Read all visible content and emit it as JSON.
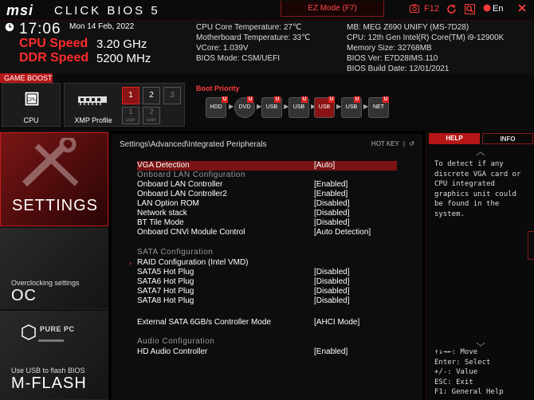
{
  "topbar": {
    "logo": "msi",
    "brand": "CLICK BIOS 5",
    "ez_mode": "EZ Mode (F7)",
    "f12": "F12",
    "language": "En"
  },
  "status": {
    "time": "17:06",
    "date": "Mon 14 Feb, 2022",
    "cpu_speed_label": "CPU Speed",
    "cpu_speed_value": "3.20 GHz",
    "ddr_speed_label": "DDR Speed",
    "ddr_speed_value": "5200 MHz"
  },
  "sysinfo_left": [
    "CPU Core Temperature: 27℃",
    "Motherboard Temperature: 33℃",
    "VCore: 1.039V",
    "BIOS Mode: CSM/UEFI"
  ],
  "sysinfo_right": [
    "MB: MEG Z690 UNIFY (MS-7D28)",
    "CPU: 12th Gen Intel(R) Core(TM) i9-12900K",
    "Memory Size: 32768MB",
    "BIOS Ver: E7D28IMS.110",
    "BIOS Build Date: 12/01/2021"
  ],
  "game_boost": {
    "label": "GAME BOOST",
    "cpu": "CPU",
    "xmp": "XMP Profile",
    "profiles": [
      "1",
      "2",
      "3"
    ],
    "user_profiles": [
      "1",
      "2"
    ],
    "user_label": "user"
  },
  "boot": {
    "title": "Boot Priority",
    "devices": [
      "HDD",
      "DVD",
      "USB",
      "USB",
      "USB",
      "USB",
      "NET"
    ],
    "badge": "U"
  },
  "nav": {
    "settings": "SETTINGS",
    "oc_sub": "Overclocking settings",
    "oc": "OC",
    "pure_pc": "PURE PC",
    "mflash_sub": "Use USB to flash BIOS",
    "mflash": "M-FLASH"
  },
  "main": {
    "breadcrumb": "Settings\\Advanced\\Integrated Peripherals",
    "hotkey": "HOT KEY",
    "hotkey_sep": "|",
    "back": "↺",
    "rows": [
      {
        "label": "VGA Detection",
        "value": "[Auto]"
      },
      {
        "label": "Onboard LAN Configuration",
        "value": ""
      },
      {
        "label": "Onboard LAN Controller",
        "value": "[Enabled]"
      },
      {
        "label": "Onboard LAN Controller2",
        "value": "[Enabled]"
      },
      {
        "label": "LAN Option ROM",
        "value": "[Disabled]"
      },
      {
        "label": "Network stack",
        "value": "[Disabled]"
      },
      {
        "label": "BT Tile Mode",
        "value": "[Disabled]"
      },
      {
        "label": "Onboard CNVi Module Control",
        "value": "[Auto Detection]"
      },
      {
        "label": "SATA Configuration",
        "value": ""
      },
      {
        "label": "RAID Configuration (Intel VMD)",
        "value": ""
      },
      {
        "label": "SATA5 Hot Plug",
        "value": "[Disabled]"
      },
      {
        "label": "SATA6 Hot Plug",
        "value": "[Disabled]"
      },
      {
        "label": "SATA7 Hot Plug",
        "value": "[Disabled]"
      },
      {
        "label": "SATA8 Hot Plug",
        "value": "[Disabled]"
      },
      {
        "label": "External SATA 6GB/s Controller Mode",
        "value": "[AHCI Mode]"
      },
      {
        "label": "Audio Configuration",
        "value": ""
      },
      {
        "label": "HD Audio Controller",
        "value": "[Enabled]"
      }
    ]
  },
  "help": {
    "tab_help": "HELP",
    "tab_info": "INFO",
    "text": "To detect if any discrete VGA card or CPU integrated graphics unit could be found in the system.",
    "keys": [
      "↑↓→←: Move",
      "Enter: Select",
      "+/-: Value",
      "ESC: Exit",
      "F1: General Help"
    ]
  },
  "colors": {
    "accent": "#b51616",
    "speed": "#ff2b2b",
    "selected_row": "#7a1414"
  }
}
